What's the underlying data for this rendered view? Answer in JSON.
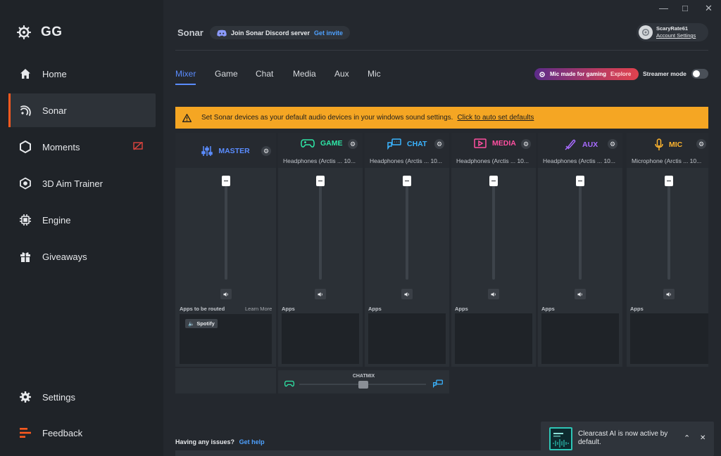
{
  "app": {
    "logo_text": "GG"
  },
  "sidebar": {
    "items": [
      {
        "label": "Home",
        "icon": "home-icon"
      },
      {
        "label": "Sonar",
        "icon": "sonar-icon",
        "active": true
      },
      {
        "label": "Moments",
        "icon": "moments-icon"
      },
      {
        "label": "3D Aim Trainer",
        "icon": "aim-icon"
      },
      {
        "label": "Engine",
        "icon": "engine-icon"
      },
      {
        "label": "Giveaways",
        "icon": "gift-icon"
      }
    ],
    "settings_label": "Settings",
    "feedback_label": "Feedback"
  },
  "header": {
    "title": "Sonar",
    "discord_label": "Join Sonar Discord server",
    "discord_link": "Get invite",
    "account_name": "ScaryRate61",
    "account_settings": "Account Settings"
  },
  "tabs": [
    "Mixer",
    "Game",
    "Chat",
    "Media",
    "Aux",
    "Mic"
  ],
  "promo": {
    "label": "Mic made for gaming",
    "link": "Explore"
  },
  "streamer_mode_label": "Streamer mode",
  "warning": {
    "text": "Set Sonar devices as your default audio devices in your windows sound settings.",
    "link": "Click to auto set defaults"
  },
  "mixer": {
    "master": {
      "name": "MASTER",
      "apps_label": "Apps to be routed",
      "learn_more": "Learn More",
      "app_chip": "Spotify"
    },
    "channels": [
      {
        "name": "GAME",
        "device": "Headphones (Arctis ... 10...",
        "apps_label": "Apps",
        "color": "#2ee6a6"
      },
      {
        "name": "CHAT",
        "device": "Headphones (Arctis ... 10...",
        "apps_label": "Apps",
        "color": "#3ab4ff"
      },
      {
        "name": "MEDIA",
        "device": "Headphones (Arctis ... 10...",
        "apps_label": "Apps",
        "color": "#ff4fa0"
      },
      {
        "name": "AUX",
        "device": "Headphones (Arctis ... 10...",
        "apps_label": "Apps",
        "color": "#a86bff"
      },
      {
        "name": "MIC",
        "device": "Microphone (Arctis ... 10...",
        "apps_label": "Apps",
        "color": "#ffb52e"
      }
    ],
    "chatmix_label": "CHATMIX"
  },
  "footer": {
    "issues_text": "Having any issues?",
    "help_link": "Get help"
  },
  "toast": {
    "text": "Clearcast AI is now active by default."
  },
  "colors": {
    "accent": "#ff5a1f",
    "tab_active": "#5a8cff",
    "master": "#5a8cff",
    "warning": "#f5a623"
  }
}
